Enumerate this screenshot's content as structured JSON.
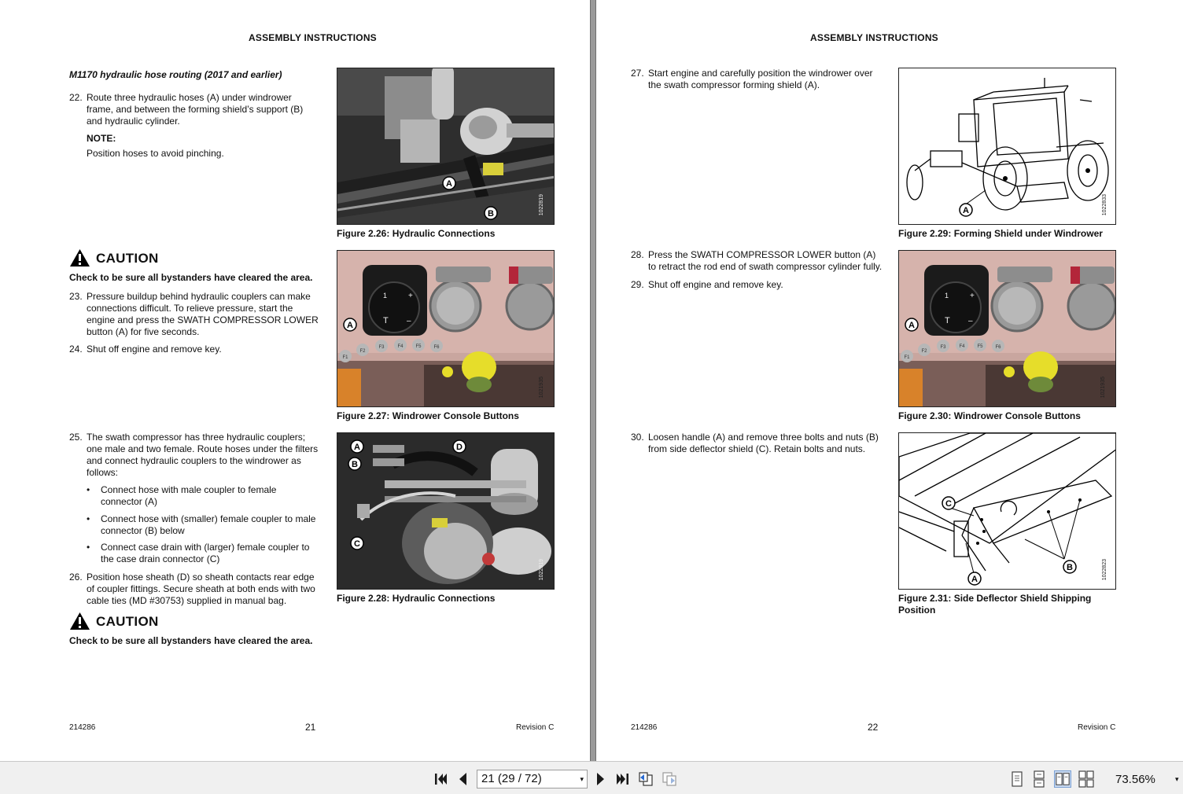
{
  "left_page": {
    "header": "ASSEMBLY INSTRUCTIONS",
    "section_title": "M1170 hydraulic hose routing (2017 and earlier)",
    "step22": {
      "num": "22.",
      "lines": [
        "Route three hydraulic hoses (A) under windrower",
        "frame, and between the forming shield’s support (B)",
        "and hydraulic cylinder."
      ]
    },
    "note_label": "NOTE:",
    "note_text": "Position hoses to avoid pinching.",
    "caution1": {
      "title": "CAUTION",
      "text": "Check to be sure all bystanders have cleared the area."
    },
    "step23": {
      "num": "23.",
      "lines": [
        "Pressure buildup behind hydraulic couplers can make",
        "connections difficult. To relieve pressure, start the",
        "engine and press the SWATH COMPRESSOR LOWER",
        "button (A) for five seconds."
      ]
    },
    "step24": {
      "num": "24.",
      "lines": [
        "Shut off engine and remove key."
      ]
    },
    "step25": {
      "num": "25.",
      "lines": [
        "The swath compressor has three hydraulic couplers;",
        "one male and two female. Route hoses under the filters",
        "and connect hydraulic couplers to the windrower as",
        "follows:"
      ]
    },
    "bullets": [
      {
        "dot": "•",
        "lines": [
          "Connect hose with male coupler to female",
          "connector (A)"
        ]
      },
      {
        "dot": "•",
        "lines": [
          "Connect hose with (smaller) female coupler to male",
          "connector (B) below"
        ]
      },
      {
        "dot": "•",
        "lines": [
          "Connect case drain with (larger) female coupler to",
          "the case drain connector (C)"
        ]
      }
    ],
    "step26": {
      "num": "26.",
      "lines": [
        "Position hose sheath (D) so sheath contacts rear edge",
        "of coupler fittings. Secure sheath at both ends with two",
        "cable ties (MD #30753) supplied in manual bag."
      ]
    },
    "caution2": {
      "title": "CAUTION",
      "text": "Check to be sure all bystanders have cleared the area."
    },
    "fig226": {
      "caption": "Figure 2.26: Hydraulic Connections",
      "id": "1022819",
      "labels": [
        "A",
        "B"
      ]
    },
    "fig227": {
      "caption": "Figure 2.27: Windrower Console Buttons",
      "id": "1021935",
      "labels": [
        "A"
      ],
      "keys": [
        "F1",
        "F2",
        "F3",
        "F4",
        "F5",
        "F6"
      ],
      "console": [
        "+",
        "T",
        "–",
        "1"
      ]
    },
    "fig228": {
      "caption": "Figure 2.28: Hydraulic Connections",
      "id": "1022819",
      "labels": [
        "A",
        "B",
        "C",
        "D"
      ]
    },
    "footer_doc": "214286",
    "page_number": "21",
    "footer_rev": "Revision  C"
  },
  "right_page": {
    "header": "ASSEMBLY INSTRUCTIONS",
    "step27": {
      "num": "27.",
      "lines": [
        "Start engine and carefully position the windrower over",
        "the swath compressor forming shield (A)."
      ]
    },
    "step28": {
      "num": "28.",
      "lines": [
        "Press the SWATH COMPRESSOR LOWER button (A)",
        "to retract the rod end of swath compressor cylinder fully."
      ]
    },
    "step29": {
      "num": "29.",
      "lines": [
        "Shut off engine and remove key."
      ]
    },
    "step30": {
      "num": "30.",
      "lines": [
        "Loosen handle (A) and remove three bolts and nuts (B)",
        "from side deflector shield (C). Retain bolts and nuts."
      ]
    },
    "fig229": {
      "caption": "Figure 2.29: Forming Shield under Windrower",
      "id": "1022833",
      "labels": [
        "A"
      ]
    },
    "fig230": {
      "caption": "Figure 2.30: Windrower Console Buttons",
      "id": "1021935",
      "labels": [
        "A"
      ],
      "keys": [
        "F1",
        "F2",
        "F3",
        "F4",
        "F5",
        "F6"
      ],
      "console": [
        "+",
        "T",
        "–",
        "1"
      ]
    },
    "fig231": {
      "caption_lines": [
        "Figure 2.31: Side Deflector Shield Shipping",
        "Position"
      ],
      "id": "1022823",
      "labels": [
        "A",
        "B",
        "C"
      ]
    },
    "footer_doc": "214286",
    "page_number": "22",
    "footer_rev": "Revision  C"
  },
  "toolbar": {
    "page_field": "21 (29 / 72)",
    "dropdown_arrow": "▾",
    "zoom": "73.56%",
    "zoom_arrow": "▾",
    "icons": [
      "first-page-icon",
      "prev-page-icon",
      "next-page-icon",
      "last-page-icon",
      "go-back-icon",
      "go-forward-icon",
      "single-page-view-icon",
      "continuous-view-icon",
      "facing-view-icon",
      "continuous-facing-view-icon"
    ]
  },
  "colors": {
    "gutter": "#9a9a9a",
    "toolbar_bg": "#f0f0f0",
    "photo_dark": "#3a3a3a",
    "console_pink": "#d9a8a0",
    "yellow_button": "#e6dd2a"
  }
}
